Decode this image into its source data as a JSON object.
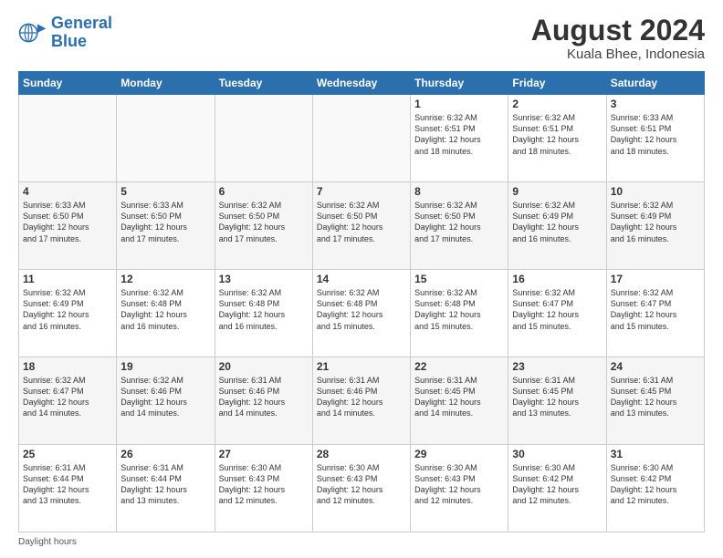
{
  "logo": {
    "line1": "General",
    "line2": "Blue"
  },
  "header": {
    "month": "August 2024",
    "location": "Kuala Bhee, Indonesia"
  },
  "days_of_week": [
    "Sunday",
    "Monday",
    "Tuesday",
    "Wednesday",
    "Thursday",
    "Friday",
    "Saturday"
  ],
  "footer": "Daylight hours",
  "weeks": [
    [
      {
        "day": "",
        "info": ""
      },
      {
        "day": "",
        "info": ""
      },
      {
        "day": "",
        "info": ""
      },
      {
        "day": "",
        "info": ""
      },
      {
        "day": "1",
        "info": "Sunrise: 6:32 AM\nSunset: 6:51 PM\nDaylight: 12 hours\nand 18 minutes."
      },
      {
        "day": "2",
        "info": "Sunrise: 6:32 AM\nSunset: 6:51 PM\nDaylight: 12 hours\nand 18 minutes."
      },
      {
        "day": "3",
        "info": "Sunrise: 6:33 AM\nSunset: 6:51 PM\nDaylight: 12 hours\nand 18 minutes."
      }
    ],
    [
      {
        "day": "4",
        "info": "Sunrise: 6:33 AM\nSunset: 6:50 PM\nDaylight: 12 hours\nand 17 minutes."
      },
      {
        "day": "5",
        "info": "Sunrise: 6:33 AM\nSunset: 6:50 PM\nDaylight: 12 hours\nand 17 minutes."
      },
      {
        "day": "6",
        "info": "Sunrise: 6:32 AM\nSunset: 6:50 PM\nDaylight: 12 hours\nand 17 minutes."
      },
      {
        "day": "7",
        "info": "Sunrise: 6:32 AM\nSunset: 6:50 PM\nDaylight: 12 hours\nand 17 minutes."
      },
      {
        "day": "8",
        "info": "Sunrise: 6:32 AM\nSunset: 6:50 PM\nDaylight: 12 hours\nand 17 minutes."
      },
      {
        "day": "9",
        "info": "Sunrise: 6:32 AM\nSunset: 6:49 PM\nDaylight: 12 hours\nand 16 minutes."
      },
      {
        "day": "10",
        "info": "Sunrise: 6:32 AM\nSunset: 6:49 PM\nDaylight: 12 hours\nand 16 minutes."
      }
    ],
    [
      {
        "day": "11",
        "info": "Sunrise: 6:32 AM\nSunset: 6:49 PM\nDaylight: 12 hours\nand 16 minutes."
      },
      {
        "day": "12",
        "info": "Sunrise: 6:32 AM\nSunset: 6:48 PM\nDaylight: 12 hours\nand 16 minutes."
      },
      {
        "day": "13",
        "info": "Sunrise: 6:32 AM\nSunset: 6:48 PM\nDaylight: 12 hours\nand 16 minutes."
      },
      {
        "day": "14",
        "info": "Sunrise: 6:32 AM\nSunset: 6:48 PM\nDaylight: 12 hours\nand 15 minutes."
      },
      {
        "day": "15",
        "info": "Sunrise: 6:32 AM\nSunset: 6:48 PM\nDaylight: 12 hours\nand 15 minutes."
      },
      {
        "day": "16",
        "info": "Sunrise: 6:32 AM\nSunset: 6:47 PM\nDaylight: 12 hours\nand 15 minutes."
      },
      {
        "day": "17",
        "info": "Sunrise: 6:32 AM\nSunset: 6:47 PM\nDaylight: 12 hours\nand 15 minutes."
      }
    ],
    [
      {
        "day": "18",
        "info": "Sunrise: 6:32 AM\nSunset: 6:47 PM\nDaylight: 12 hours\nand 14 minutes."
      },
      {
        "day": "19",
        "info": "Sunrise: 6:32 AM\nSunset: 6:46 PM\nDaylight: 12 hours\nand 14 minutes."
      },
      {
        "day": "20",
        "info": "Sunrise: 6:31 AM\nSunset: 6:46 PM\nDaylight: 12 hours\nand 14 minutes."
      },
      {
        "day": "21",
        "info": "Sunrise: 6:31 AM\nSunset: 6:46 PM\nDaylight: 12 hours\nand 14 minutes."
      },
      {
        "day": "22",
        "info": "Sunrise: 6:31 AM\nSunset: 6:45 PM\nDaylight: 12 hours\nand 14 minutes."
      },
      {
        "day": "23",
        "info": "Sunrise: 6:31 AM\nSunset: 6:45 PM\nDaylight: 12 hours\nand 13 minutes."
      },
      {
        "day": "24",
        "info": "Sunrise: 6:31 AM\nSunset: 6:45 PM\nDaylight: 12 hours\nand 13 minutes."
      }
    ],
    [
      {
        "day": "25",
        "info": "Sunrise: 6:31 AM\nSunset: 6:44 PM\nDaylight: 12 hours\nand 13 minutes."
      },
      {
        "day": "26",
        "info": "Sunrise: 6:31 AM\nSunset: 6:44 PM\nDaylight: 12 hours\nand 13 minutes."
      },
      {
        "day": "27",
        "info": "Sunrise: 6:30 AM\nSunset: 6:43 PM\nDaylight: 12 hours\nand 12 minutes."
      },
      {
        "day": "28",
        "info": "Sunrise: 6:30 AM\nSunset: 6:43 PM\nDaylight: 12 hours\nand 12 minutes."
      },
      {
        "day": "29",
        "info": "Sunrise: 6:30 AM\nSunset: 6:43 PM\nDaylight: 12 hours\nand 12 minutes."
      },
      {
        "day": "30",
        "info": "Sunrise: 6:30 AM\nSunset: 6:42 PM\nDaylight: 12 hours\nand 12 minutes."
      },
      {
        "day": "31",
        "info": "Sunrise: 6:30 AM\nSunset: 6:42 PM\nDaylight: 12 hours\nand 12 minutes."
      }
    ]
  ]
}
